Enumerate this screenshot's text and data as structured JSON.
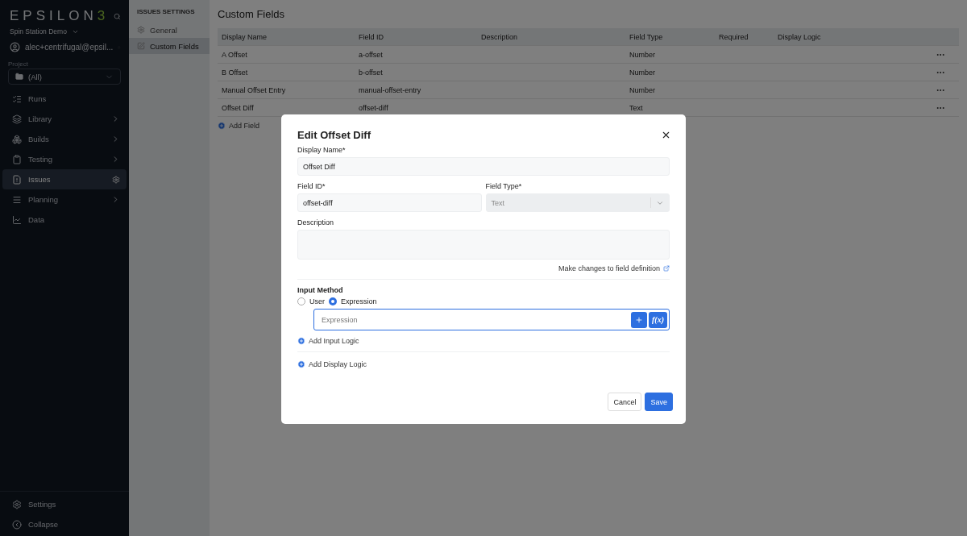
{
  "sidebar": {
    "logo": {
      "text": "EPSILON",
      "mark": "3"
    },
    "workspace": "Spin Station Demo",
    "user": "alec+centrifugal@epsil...",
    "project_label": "Project",
    "project": "(All)",
    "items": [
      {
        "label": "Runs",
        "kind": "plain",
        "selected": false
      },
      {
        "label": "Library",
        "kind": "chevron",
        "selected": false
      },
      {
        "label": "Builds",
        "kind": "chevron",
        "selected": false
      },
      {
        "label": "Testing",
        "kind": "chevron",
        "selected": false
      },
      {
        "label": "Issues",
        "kind": "gear",
        "selected": true
      },
      {
        "label": "Planning",
        "kind": "chevron",
        "selected": false
      },
      {
        "label": "Data",
        "kind": "plain",
        "selected": false
      }
    ],
    "footer": [
      {
        "label": "Settings"
      },
      {
        "label": "Collapse"
      }
    ]
  },
  "settings_nav": {
    "title": "ISSUES SETTINGS",
    "items": [
      {
        "label": "General",
        "selected": false
      },
      {
        "label": "Custom Fields",
        "selected": true
      }
    ]
  },
  "page": {
    "title": "Custom Fields",
    "add_field": "Add Field"
  },
  "table": {
    "columns": [
      "Display Name",
      "Field ID",
      "Description",
      "Field Type",
      "Required",
      "Display Logic"
    ],
    "rows": [
      [
        "A Offset",
        "a-offset",
        "",
        "Number",
        "",
        ""
      ],
      [
        "B Offset",
        "b-offset",
        "",
        "Number",
        "",
        ""
      ],
      [
        "Manual Offset Entry",
        "manual-offset-entry",
        "",
        "Number",
        "",
        ""
      ],
      [
        "Offset Diff",
        "offset-diff",
        "",
        "Text",
        "",
        ""
      ]
    ]
  },
  "modal": {
    "title": "Edit Offset Diff",
    "display_name_label": "Display Name*",
    "display_name": "Offset Diff",
    "field_id_label": "Field ID*",
    "field_id": "offset-diff",
    "field_type_label": "Field Type*",
    "field_type": "Text",
    "field_type_disabled": true,
    "description_label": "Description",
    "definition_link": "Make changes to field definition",
    "input_method_label": "Input Method",
    "input_methods": [
      {
        "label": "User",
        "selected": false
      },
      {
        "label": "Expression",
        "selected": true
      }
    ],
    "expression_placeholder": "Expression",
    "function_button": "f(x)",
    "add_input_logic": "Add Input Logic",
    "add_display_logic": "Add Display Logic",
    "cancel": "Cancel",
    "save": "Save"
  }
}
